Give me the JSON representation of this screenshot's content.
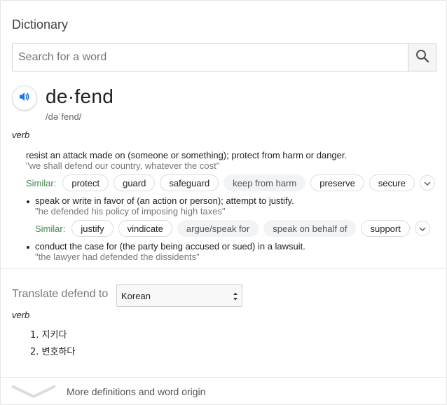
{
  "header": {
    "title": "Dictionary"
  },
  "search": {
    "placeholder": "Search for a word",
    "value": ""
  },
  "entry": {
    "word": "de·fend",
    "phonetic": "/dəˈfend/",
    "part_of_speech": "verb",
    "senses": [
      {
        "definition": "resist an attack made on (someone or something); protect from harm or danger.",
        "example": "\"we shall defend our country, whatever the cost\"",
        "similar_label": "Similar:",
        "similar": [
          {
            "word": "protect",
            "bordered": true
          },
          {
            "word": "guard",
            "bordered": true
          },
          {
            "word": "safeguard",
            "bordered": true
          },
          {
            "word": "keep from harm",
            "bordered": false
          },
          {
            "word": "preserve",
            "bordered": true
          },
          {
            "word": "secure",
            "bordered": true
          }
        ]
      },
      {
        "definition": "speak or write in favor of (an action or person); attempt to justify.",
        "example": "\"he defended his policy of imposing high taxes\"",
        "similar_label": "Similar:",
        "similar": [
          {
            "word": "justify",
            "bordered": true
          },
          {
            "word": "vindicate",
            "bordered": true
          },
          {
            "word": "argue/speak for",
            "bordered": false
          },
          {
            "word": "speak on behalf of",
            "bordered": false
          },
          {
            "word": "support",
            "bordered": true
          }
        ]
      },
      {
        "definition": "conduct the case for (the party being accused or sued) in a lawsuit.",
        "example": "\"the lawyer had defended the dissidents\""
      }
    ]
  },
  "translate": {
    "label": "Translate defend to",
    "language": "Korean",
    "part_of_speech": "verb",
    "items": [
      "1. 지키다",
      "2. 변호하다"
    ]
  },
  "footer": {
    "more_label": "More definitions and word origin"
  },
  "colors": {
    "similar_green": "#458a4f",
    "icon_blue": "#1a73e8"
  }
}
